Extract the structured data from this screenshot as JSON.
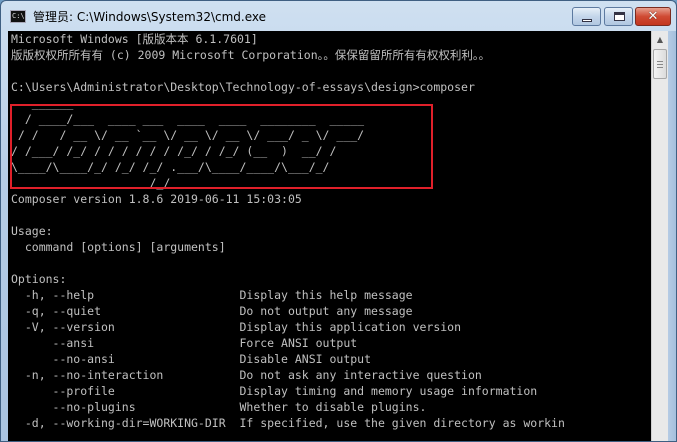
{
  "window": {
    "title": "管理员: C:\\Windows\\System32\\cmd.exe",
    "icon_text": "C:\\",
    "controls": {
      "close_glyph": "✕"
    }
  },
  "console": {
    "lines": [
      "Microsoft Windows [版版本本 6.1.7601]",
      "版版权权所所有有 (c) 2009 Microsoft Corporation。。保保留留所所有有权权利利。。",
      "",
      "C:\\Users\\Administrator\\Desktop\\Technology-of-essays\\design>composer",
      "   ______",
      "  / ____/___  ____ ___  ____  ____  ________  _____",
      " / /   / __ \\/ __ `__ \\/ __ \\/ __ \\/ ___/ _ \\/ ___/",
      "/ /___/ /_/ / / / / / / /_/ / /_/ (__  )  __/ /",
      "\\____/\\____/_/ /_/ /_/ .___/\\____/____/\\___/_/",
      "                    /_/",
      "Composer version 1.8.6 2019-06-11 15:03:05",
      "",
      "Usage:",
      "  command [options] [arguments]",
      "",
      "Options:",
      "  -h, --help                     Display this help message",
      "  -q, --quiet                    Do not output any message",
      "  -V, --version                  Display this application version",
      "      --ansi                     Force ANSI output",
      "      --no-ansi                  Disable ANSI output",
      "  -n, --no-interaction           Do not ask any interactive question",
      "      --profile                  Display timing and memory usage information",
      "      --no-plugins               Whether to disable plugins.",
      "  -d, --working-dir=WORKING-DIR  If specified, use the given directory as workin"
    ]
  },
  "scrollbar": {
    "up_arrow": "▲",
    "position": 0.0
  }
}
